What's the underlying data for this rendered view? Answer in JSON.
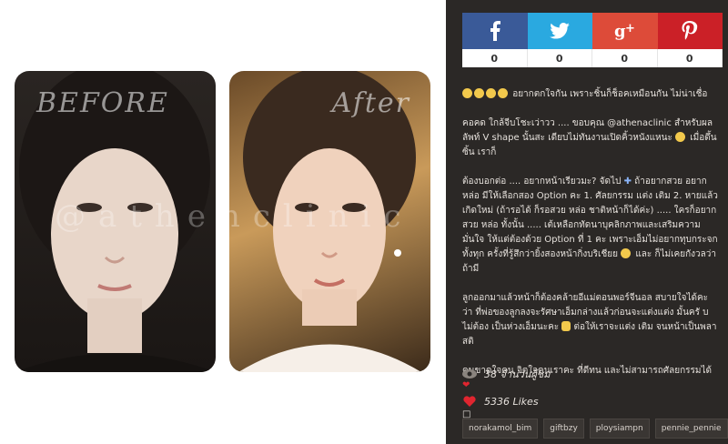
{
  "photos": {
    "before_label": "BEFORE",
    "after_label": "After",
    "watermark": "@athenclinic"
  },
  "share": {
    "items": [
      {
        "network": "facebook",
        "icon": "facebook-icon",
        "count": "0",
        "color": "#3a5a98"
      },
      {
        "network": "twitter",
        "icon": "twitter-icon",
        "count": "0",
        "color": "#2aa9e0"
      },
      {
        "network": "googleplus",
        "icon": "google-plus-icon",
        "count": "0",
        "color": "#dd4b39"
      },
      {
        "network": "pinterest",
        "icon": "pinterest-icon",
        "count": "0",
        "color": "#cb2027"
      }
    ]
  },
  "caption": {
    "p1": "อยากตกใจกัน เพราะชิ้นก็ช็อคเหมือนกัน ไม่น่าเชื่อ",
    "p2": "คอคด ใกล้จีบโชะเว่าวว .... ขอบคุณ @athenaclinic สำหรับผลลัพท์ V shape นั้นสะ เดียบไม่ทันงานเปิดคิ้วหนังแหนะ",
    "p2b": "เมื่อดึ้นซิ้น เราก็",
    "p3a": "ต้องบอกต่อ .... อยากหน้าเรียวมะ? จัดไป",
    "p3b": "ถ้าอยากสวย อยาก",
    "p4": "หล่อ มีให้เลือกสอง Option คะ 1. ศัลยกรรม แต่ง เติม 2. หายแล้ว เกิดใหม่ (ถ้ารอได้ ก็รอสวย หล่อ ชาติหน้าก็ได้ค่ะ) ..... ใครก็อยาก สวย หล่อ ทั้งนั้น ..... เต้เหลือกทัดนาบุคลิกภาพและเสริมความมั่นใจ ให้แต่ต้องด้วย Option ที่ 1 คะ เพราะเอ็มไม่อยากทุบกระจกทั้งทุก ครั้งที่รู้สึกว่ายิ้งสองหน้ากิ่งบริเชียย",
    "p4b": "และ ก็ไม่เคยกังวลว่า ถ้ามี",
    "p5": "ลูกออกมาแล้วหน้าก็ต้องคล้ายอีแม่ตอนพอร์จีนอล สบายใจได้คะ ว่า ที่พ่อของลูกลงจะรัศษาเอ็มกล่างแล้วก่อนจะแต่งแต่ง มั้นครั บไม่ต้อง เป็นห่วงเอ็มนะคะ",
    "p5b": "ต่อให้เราจะแต่ง เติม จนหน้าเป็นพลาสติ",
    "p6": "คนขาดใจคน จิตใจคนเราคะ ที่ดีทน และไม่สามารถศัลยกรรมได้",
    "p7": "□"
  },
  "stats": {
    "views": "38 จำนวนผู้ชม",
    "likes": "5336 Likes"
  },
  "tags": [
    "norakamol_bim",
    "giftbzy",
    "ploysiampn",
    "pennie_pennie"
  ]
}
